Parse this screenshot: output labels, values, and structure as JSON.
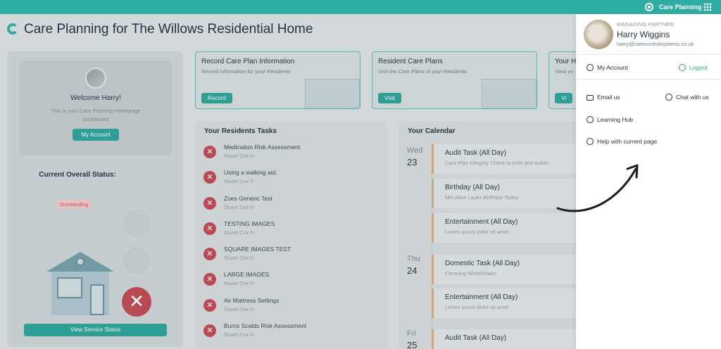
{
  "topbar": {
    "title": "Care Planning"
  },
  "page": {
    "title": "Care Planning for The Willows Residential Home"
  },
  "welcome": {
    "title": "Welcome Harry!",
    "subtitle": "This is your Care Planning Homepage Dashboard",
    "button": "My Account"
  },
  "status": {
    "label": "Current Overall Status:",
    "badge": "Outstanding",
    "button": "View Service Status"
  },
  "cards": [
    {
      "title": "Record Care Plan Information",
      "desc": "Record information for your Residents",
      "button": "Record"
    },
    {
      "title": "Resident Care Plans",
      "desc": "Visit the Care Plans of your Residents",
      "button": "Visit"
    },
    {
      "title": "Your H",
      "desc": "View yo",
      "button": "Vi"
    }
  ],
  "tasks": {
    "title": "Your Residents Tasks",
    "items": [
      {
        "name": "Medication Risk Assessment",
        "sub": "Stuart Cox 0-"
      },
      {
        "name": "Using a walking aid.",
        "sub": "Stuart Cox 0-"
      },
      {
        "name": "Zoes Generic Test",
        "sub": "Stuart Cox 0-"
      },
      {
        "name": "TESTING IMAGES",
        "sub": "Stuart Cox 0-"
      },
      {
        "name": "SQUARE IMAGES TEST",
        "sub": "Stuart Cox 0-"
      },
      {
        "name": "LARGE IMAGES",
        "sub": "Stuart Cox 0-"
      },
      {
        "name": "Air Mattress Settings",
        "sub": "Stuart Cox 0-"
      },
      {
        "name": "Burns Scalds Risk Assessment",
        "sub": "Stuart Cox 0-"
      }
    ]
  },
  "calendar": {
    "title": "Your Calendar",
    "days": [
      {
        "day": "Wed",
        "num": "23"
      },
      {
        "day": "Thu",
        "num": "24"
      },
      {
        "day": "Fri",
        "num": "25"
      }
    ],
    "events": [
      {
        "name": "Audit Task (All Day)",
        "sub": "Care Plan Integrity Check to print and action"
      },
      {
        "name": "Birthday (All Day)",
        "sub": "Mrs Alice Lauks Birthday Today"
      },
      {
        "name": "Entertainment (All Day)",
        "sub": "Lorem ipsum dolor sit amet"
      },
      {
        "name": "Domestic Task (All Day)",
        "sub": "Cleaning Wheelchairs"
      },
      {
        "name": "Entertainment (All Day)",
        "sub": "Lorem ipsum dolor sit amet"
      },
      {
        "name": "Audit Task (All Day)",
        "sub": ""
      }
    ]
  },
  "panel": {
    "role": "MANAGING PARTNER",
    "name": "Harry Wiggins",
    "email": "harry@carecontrolsystems.co.uk",
    "my_account": "My Account",
    "logout": "Logout",
    "email_us": "Email us",
    "chat": "Chat with us",
    "learning": "Learning Hub",
    "help": "Help with current page"
  }
}
